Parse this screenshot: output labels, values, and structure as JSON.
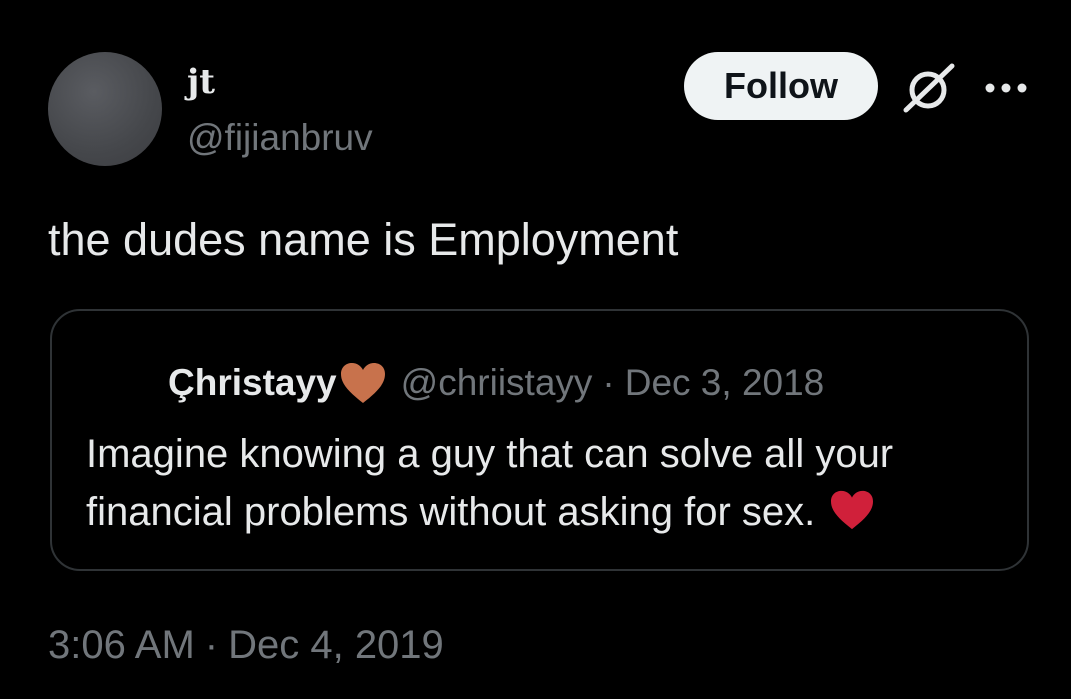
{
  "author": {
    "display_name": "jt",
    "handle": "@fijianbruv",
    "avatar_color": "#45474b"
  },
  "header": {
    "follow_label": "Follow",
    "grok_icon": "grok-icon",
    "more_icon": "more-icon"
  },
  "tweet": {
    "text": "the dudes name is Employment"
  },
  "quote": {
    "display_name": "Çhristayy",
    "name_emoji": "orange-heart-icon",
    "handle": "@chriistayy",
    "separator": "·",
    "date": "Dec 3, 2018",
    "text_lines": [
      "Imagine knowing a guy that can solve all your",
      "financial problems without asking for sex."
    ],
    "text_emoji": "red-heart-icon"
  },
  "meta": {
    "time": "3:06 AM",
    "separator": "·",
    "date": "Dec 4, 2019"
  },
  "colors": {
    "background": "#000000",
    "primary_text": "#e7e9ea",
    "secondary_text": "#71767b",
    "border": "#2f3336",
    "follow_bg": "#eff3f4",
    "orange_heart": "#c8724c",
    "red_heart": "#d0203a"
  }
}
